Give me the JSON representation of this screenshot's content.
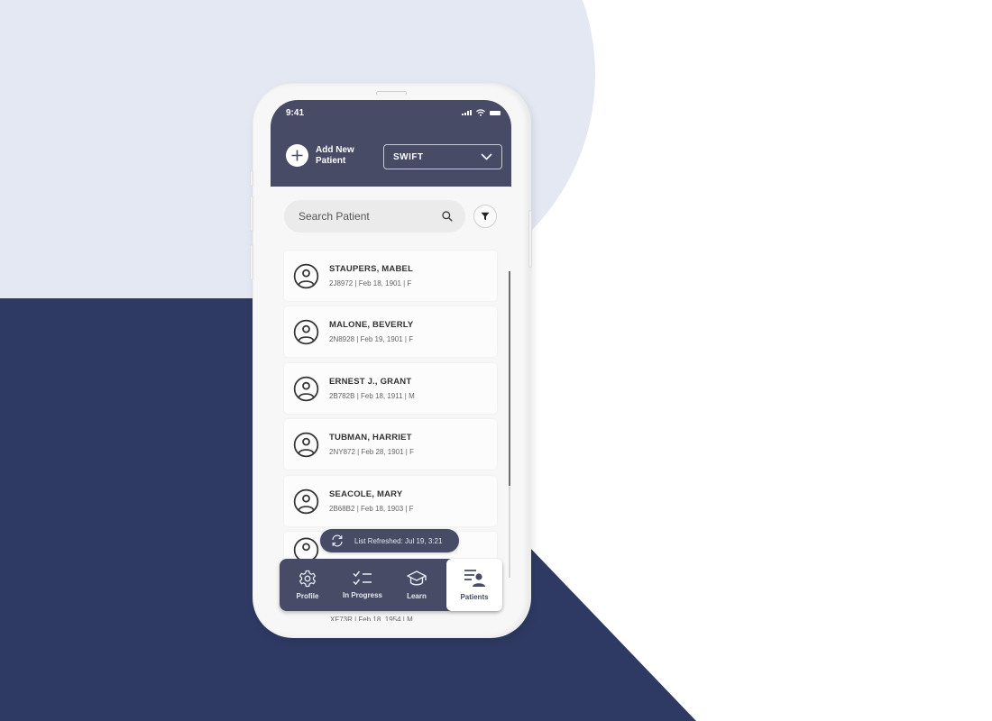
{
  "status_bar": {
    "time": "9:41"
  },
  "header": {
    "add_patient_label_line1": "Add New",
    "add_patient_label_line2": "Patient",
    "unit_select": {
      "selected": "SWIFT"
    }
  },
  "search": {
    "placeholder": "Search Patient",
    "value": ""
  },
  "patients": [
    {
      "name": "STAUPERS, MABEL",
      "meta": "2J8972 | Feb 18, 1901 | F"
    },
    {
      "name": "MALONE, BEVERLY",
      "meta": "2N8928 | Feb 19, 1901 | F"
    },
    {
      "name": "ERNEST J., GRANT",
      "meta": "2B782B | Feb 18, 1911 | M"
    },
    {
      "name": "TUBMAN, HARRIET",
      "meta": "2NY872 | Feb 28, 1901 | F"
    },
    {
      "name": "SEACOLE, MARY",
      "meta": "2B68B2 | Feb 18, 1903 | F"
    }
  ],
  "partial_patient": {
    "meta": "XF73R | Feb 18, 1954 | M"
  },
  "toast": {
    "text": "List Refreshed: Jul 19, 3:21"
  },
  "tabs": [
    {
      "label": "Profile",
      "icon": "gear-icon",
      "active": false
    },
    {
      "label": "In Progress",
      "icon": "checklist-icon",
      "active": false
    },
    {
      "label": "Learn",
      "icon": "graduation-cap-icon",
      "active": false
    },
    {
      "label": "Patients",
      "icon": "patient-list-icon",
      "active": true
    }
  ],
  "colors": {
    "header": "#474b66",
    "background_light": "#e4e8f3",
    "background_dark": "#2e3a63"
  }
}
